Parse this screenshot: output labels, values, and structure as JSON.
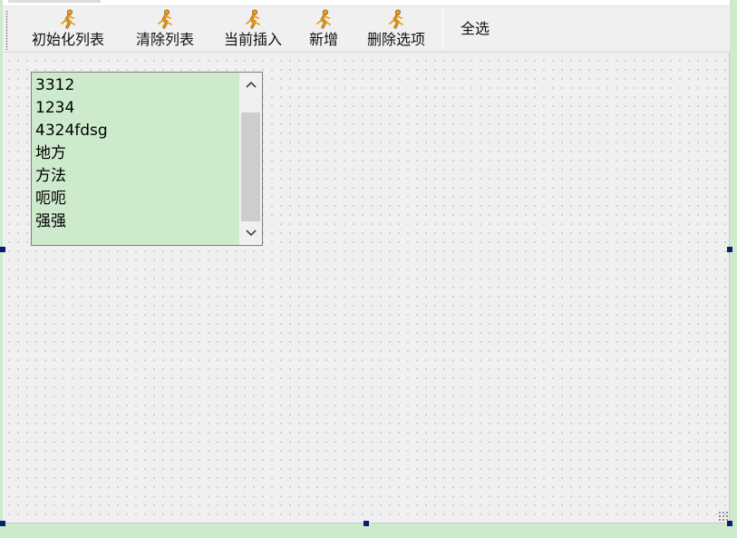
{
  "toolbar": {
    "buttons": [
      {
        "label": "初始化列表",
        "icon": "runner-icon"
      },
      {
        "label": "清除列表",
        "icon": "runner-icon"
      },
      {
        "label": "当前插入",
        "icon": "runner-icon"
      },
      {
        "label": "新增",
        "icon": "runner-icon"
      },
      {
        "label": "删除选项",
        "icon": "runner-icon"
      }
    ],
    "select_all_label": "全选"
  },
  "listbox": {
    "items": [
      "3312",
      "1234",
      "4324fdsg",
      "地方",
      "方法",
      "呃呃",
      "强强"
    ]
  },
  "colors": {
    "window_bg": "#cdeacd",
    "form_bg": "#f0f0f0",
    "listbox_bg": "#cdeacd",
    "selection_handle": "#0a1e6e",
    "icon_orange": "#f0a020"
  }
}
